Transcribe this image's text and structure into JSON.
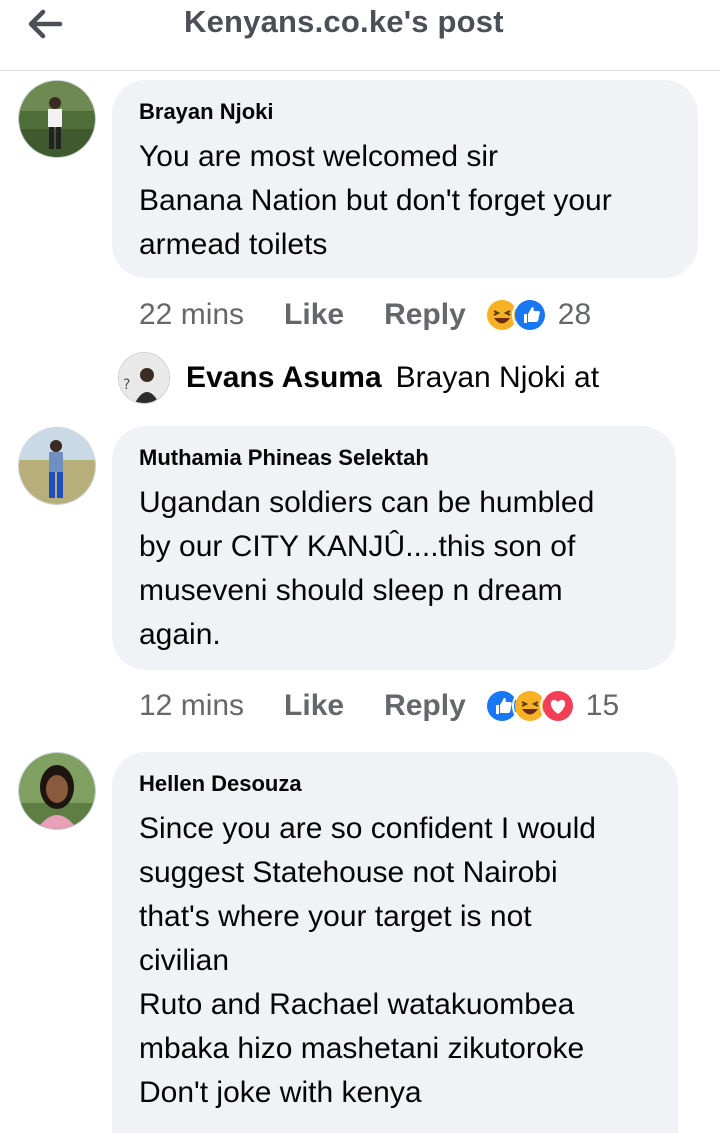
{
  "header": {
    "title": "Kenyans.co.ke's post",
    "back_icon": "arrow-left-icon"
  },
  "comments": [
    {
      "author": "Brayan Njoki",
      "lines": [
        "You are most welcomed sir",
        "Banana Nation but don't forget your",
        "armead toilets"
      ],
      "time": "22 mins",
      "like": "Like",
      "reply": "Reply",
      "reactions": [
        "haha",
        "like"
      ],
      "count": "28"
    },
    {
      "author": "Muthamia Phineas Selektah",
      "lines": [
        "Ugandan soldiers can be humbled",
        "by our CITY KANJÛ....this son of",
        "museveni should sleep n dream",
        "again."
      ],
      "time": "12 mins",
      "like": "Like",
      "reply": "Reply",
      "reactions": [
        "like",
        "haha",
        "love"
      ],
      "count": "15"
    },
    {
      "author": "Hellen Desouza",
      "lines": [
        "Since you are so confident I would",
        "suggest Statehouse not Nairobi",
        "that's where your target is not",
        "civilian",
        "Ruto and Rachael watakuombea",
        "mbaka hizo mashetani zikutoroke",
        "Don't joke with kenya"
      ]
    }
  ],
  "reply_preview": {
    "name": "Evans Asuma",
    "text": "Brayan Njoki at"
  },
  "colors": {
    "like_blue": "#1877f2",
    "love_red": "#f33e58",
    "haha_yellow": "#f7b125",
    "bubble": "#f0f2f5",
    "meta_gray": "#65676b"
  }
}
